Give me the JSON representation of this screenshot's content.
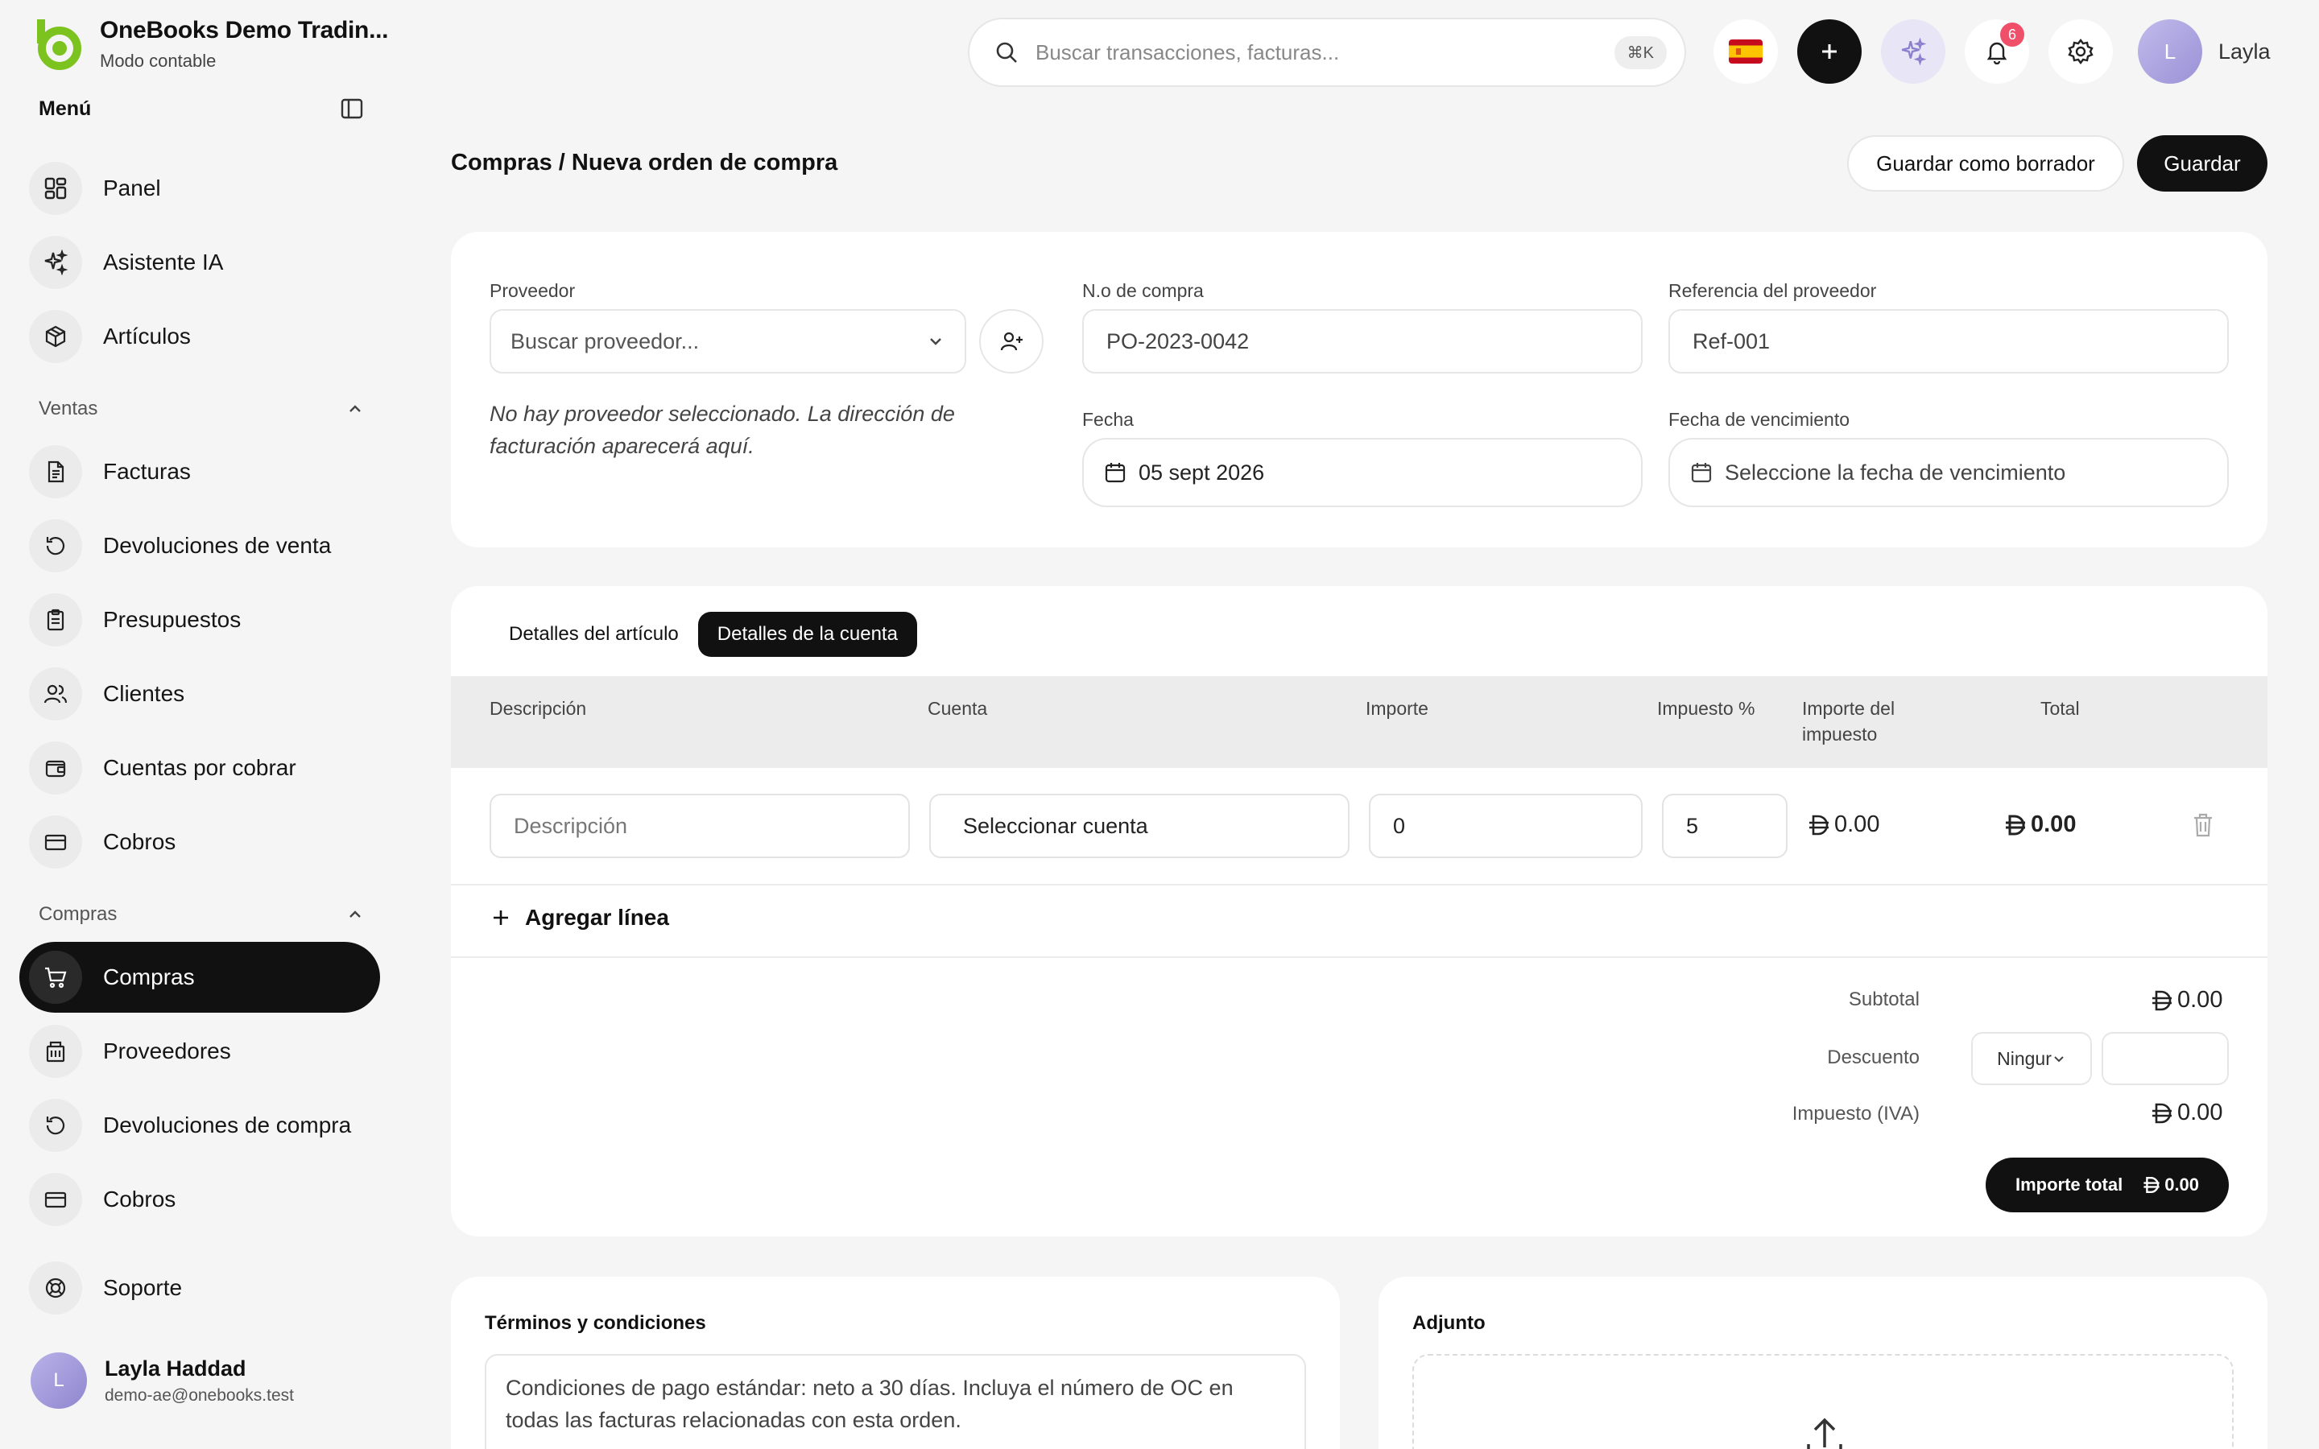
{
  "brand": {
    "name": "OneBooks Demo Tradin...",
    "mode": "Modo contable"
  },
  "menu": {
    "title": "Menú"
  },
  "nav": {
    "top": [
      {
        "label": "Panel",
        "icon": "dashboard-icon"
      },
      {
        "label": "Asistente IA",
        "icon": "sparkles-icon"
      },
      {
        "label": "Artículos",
        "icon": "box-icon"
      }
    ],
    "sales_title": "Ventas",
    "sales": [
      {
        "label": "Facturas",
        "icon": "document-icon"
      },
      {
        "label": "Devoluciones de venta",
        "icon": "refresh-icon"
      },
      {
        "label": "Presupuestos",
        "icon": "clipboard-icon"
      },
      {
        "label": "Clientes",
        "icon": "users-icon"
      },
      {
        "label": "Cuentas por cobrar",
        "icon": "wallet-icon"
      },
      {
        "label": "Cobros",
        "icon": "card-icon"
      }
    ],
    "purchases_title": "Compras",
    "purchases": [
      {
        "label": "Compras",
        "icon": "cart-icon",
        "active": true
      },
      {
        "label": "Proveedores",
        "icon": "building-icon"
      },
      {
        "label": "Devoluciones de compra",
        "icon": "refresh-icon"
      },
      {
        "label": "Cobros",
        "icon": "card-icon"
      }
    ],
    "support": {
      "label": "Soporte",
      "icon": "lifebuoy-icon"
    }
  },
  "user": {
    "initial": "L",
    "name": "Layla Haddad",
    "email": "demo-ae@onebooks.test",
    "short_name": "Layla"
  },
  "search": {
    "placeholder": "Buscar transacciones, facturas...",
    "shortcut": "⌘K"
  },
  "notifications": {
    "count": "6"
  },
  "page": {
    "breadcrumb": "Compras / Nueva orden de compra",
    "save_draft_label": "Guardar como borrador",
    "save_label": "Guardar"
  },
  "form": {
    "supplier_label": "Proveedor",
    "supplier_placeholder": "Buscar proveedor...",
    "supplier_note": "No hay proveedor seleccionado. La dirección de facturación aparecerá aquí.",
    "po_number_label": "N.o de compra",
    "po_number_value": "PO-2023-0042",
    "supplier_ref_label": "Referencia del proveedor",
    "supplier_ref_value": "Ref-001",
    "date_label": "Fecha",
    "date_value": "05 sept 2026",
    "due_date_label": "Fecha de vencimiento",
    "due_date_placeholder": "Seleccione la fecha de vencimiento"
  },
  "tabs": [
    {
      "label": "Detalles del artículo",
      "active": false
    },
    {
      "label": "Detalles de la cuenta",
      "active": true
    }
  ],
  "table": {
    "headers": [
      "Descripción",
      "Cuenta",
      "Importe",
      "Impuesto %",
      "Importe del impuesto",
      "Total"
    ],
    "row": {
      "description_placeholder": "Descripción",
      "account_value": "Seleccionar cuenta",
      "amount_value": "0",
      "tax_pct_value": "5",
      "tax_amount": "0.00",
      "total": "0.00"
    },
    "add_line_label": "Agregar línea"
  },
  "summary": {
    "subtotal_label": "Subtotal",
    "subtotal_value": "0.00",
    "discount_label": "Descuento",
    "discount_type": "Ningur",
    "tax_label": "Impuesto (IVA)",
    "tax_value": "0.00",
    "total_label": "Importe total",
    "total_value": "0.00"
  },
  "terms": {
    "title": "Términos y condiciones",
    "text": "Condiciones de pago estándar: neto a 30 días. Incluya el número de OC en todas las facturas relacionadas con esta orden."
  },
  "attachment": {
    "title": "Adjunto"
  },
  "colors": {
    "brand_green": "#7cc31f",
    "dark": "#111111",
    "badge": "#f04f6a",
    "accent_purple": "#9a91d6"
  }
}
